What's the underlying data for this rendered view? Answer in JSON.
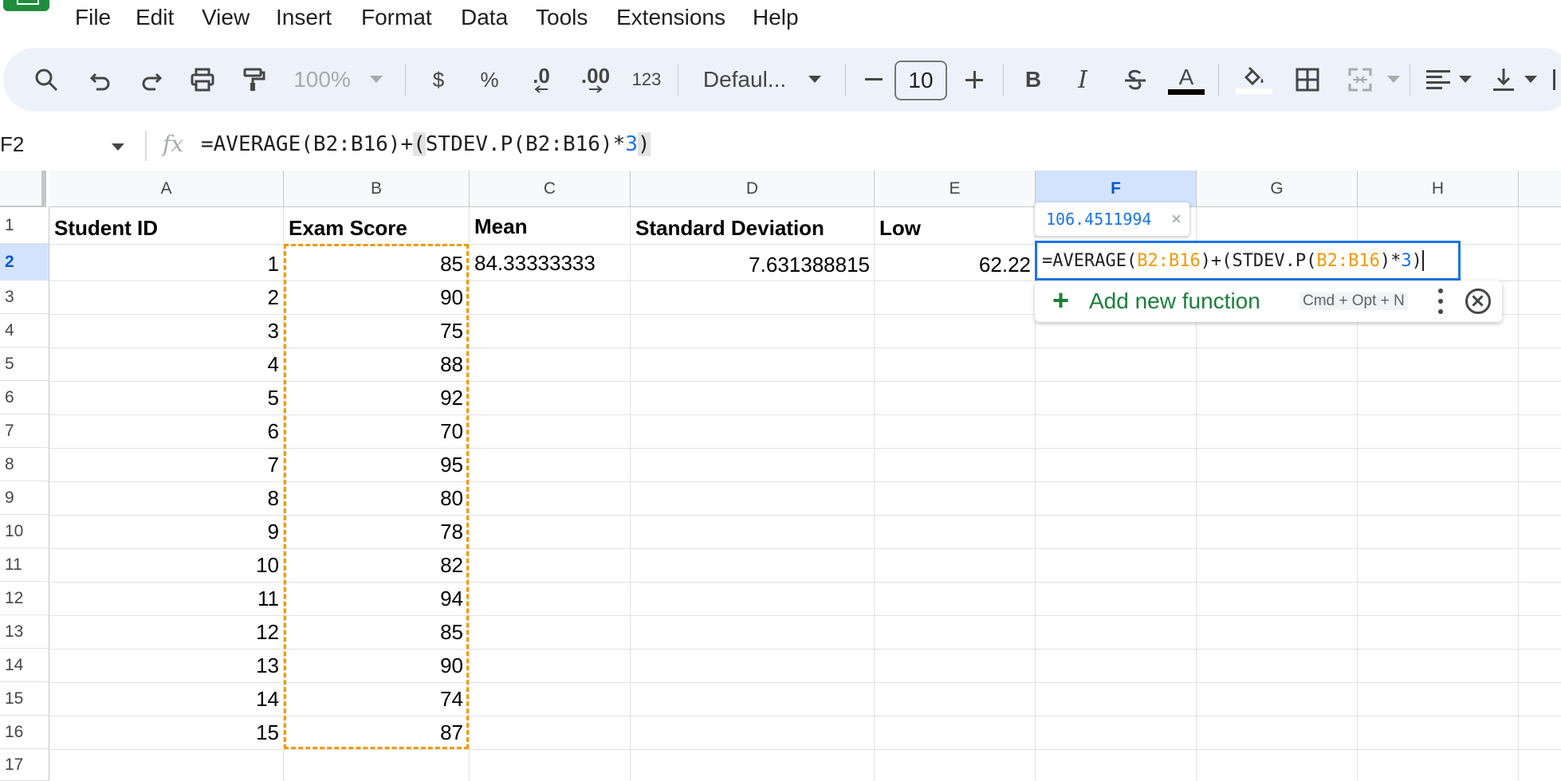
{
  "menu": [
    "File",
    "Edit",
    "View",
    "Insert",
    "Format",
    "Data",
    "Tools",
    "Extensions",
    "Help"
  ],
  "toolbar": {
    "zoom": "100%",
    "currency": "$",
    "percent": "%",
    "decrease_decimal": ".0",
    "increase_decimal": ".00",
    "more_formats": "123",
    "font_name": "Defaul...",
    "font_size": "10",
    "bold": "B",
    "italic": "I",
    "text_color_letter": "A"
  },
  "formula_bar": {
    "cell_ref": "F2",
    "fx_label": "fx",
    "formula_part1": "=AVERAGE(B2:B16)+",
    "formula_paren_open": "(",
    "formula_part2": "STDEV.P(B2:B16)*",
    "formula_number": "3",
    "formula_paren_close": ")"
  },
  "columns": [
    "A",
    "B",
    "C",
    "D",
    "E",
    "F",
    "G",
    "H"
  ],
  "rows": [
    "1",
    "2",
    "3",
    "4",
    "5",
    "6",
    "7",
    "8",
    "9",
    "10",
    "11",
    "12",
    "13",
    "14",
    "15",
    "16",
    "17"
  ],
  "headers": {
    "a1": "Student ID",
    "b1": "Exam Score",
    "c1": "Mean",
    "d1": "Standard Deviation",
    "e1": "Low"
  },
  "student_ids": [
    "1",
    "2",
    "3",
    "4",
    "5",
    "6",
    "7",
    "8",
    "9",
    "10",
    "11",
    "12",
    "13",
    "14",
    "15"
  ],
  "exam_scores": [
    "85",
    "90",
    "75",
    "88",
    "92",
    "70",
    "95",
    "80",
    "78",
    "82",
    "94",
    "85",
    "90",
    "74",
    "87"
  ],
  "row2": {
    "mean": "84.33333333",
    "std_dev": "7.631388815",
    "low": "62.22"
  },
  "editor": {
    "part1": "=AVERAGE(",
    "ref1": "B2:B16",
    "part2": ")+(STDEV.P(",
    "ref2": "B2:B16",
    "part3": ")*",
    "num": "3",
    "part4": ")"
  },
  "result_preview": "106.4511994",
  "result_close": "×",
  "function_popup": {
    "label": "Add new function",
    "shortcut": "Cmd + Opt + N"
  },
  "colors": {
    "accent": "#1a73e8",
    "range_highlight": "#f29900",
    "add_function": "#188038",
    "selected_header": "#d3e3fd"
  }
}
